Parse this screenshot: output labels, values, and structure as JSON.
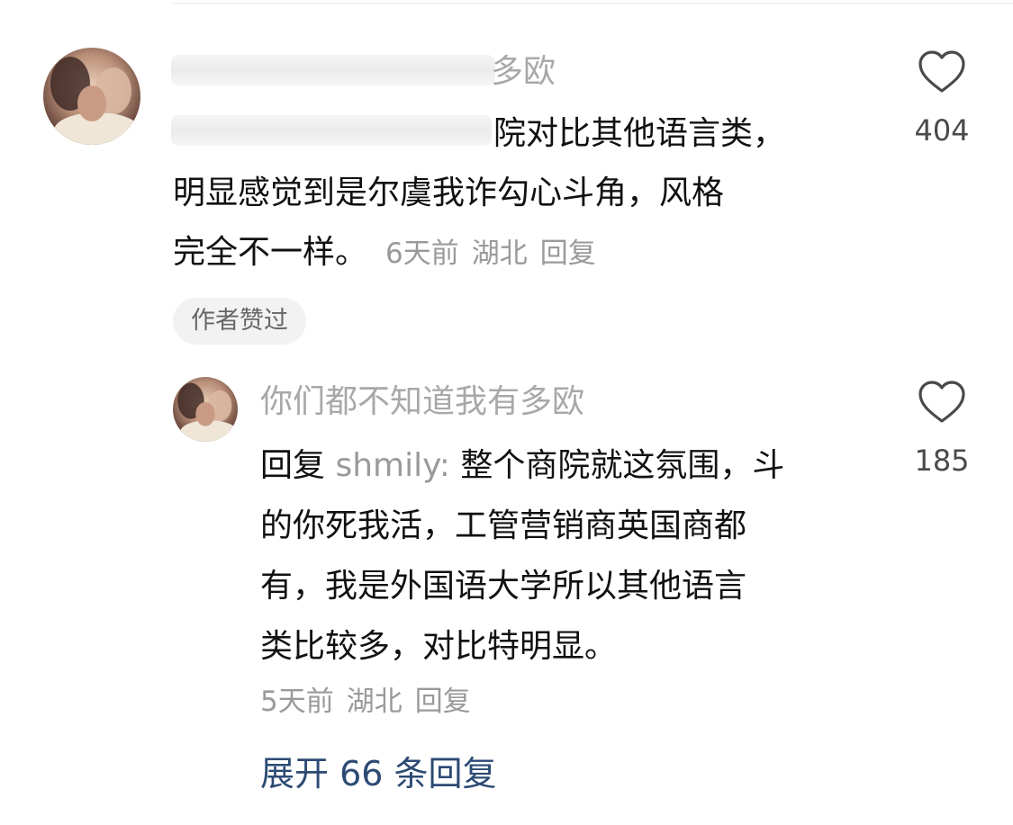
{
  "top_comment": {
    "username_visible": "多欧",
    "text_lines": [
      "院对比其他语言类，",
      "明显感觉到是尔虞我诈勾心斗角，风格",
      "完全不一样。"
    ],
    "time": "6天前",
    "location": "湖北",
    "reply_label": "回复",
    "badge": "作者赞过",
    "likes": "404"
  },
  "reply_comment": {
    "username": "你们都不知道我有多欧",
    "reply_to_label": "回复",
    "reply_target": "shmily:",
    "text_lines": [
      "整个商院就这氛围，斗",
      "的你死我活，工管营销商英国商都",
      "有，我是外国语大学所以其他语言",
      "类比较多，对比特明显。"
    ],
    "time": "5天前",
    "location": "湖北",
    "reply_label": "回复",
    "likes": "185"
  },
  "expand_replies": "展开 66 条回复",
  "icons": {
    "like": "heart-outline-icon"
  },
  "colors": {
    "link": "#2c4a73",
    "meta": "#9a9a9a",
    "text": "#111111"
  }
}
